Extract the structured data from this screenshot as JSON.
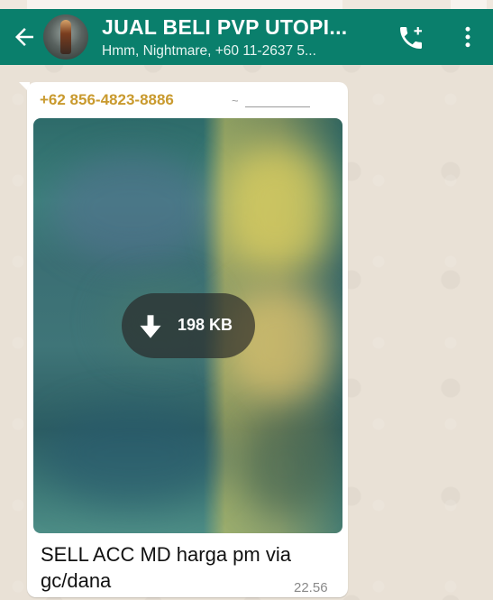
{
  "header": {
    "title": "JUAL BELI PVP UTOPI...",
    "subtitle": "Hmm, Nightmare, +60 11-2637 5...",
    "back_icon": "arrow-left-icon",
    "call_icon": "add-call-icon",
    "menu_icon": "more-vertical-icon",
    "color": "#0a7f6c"
  },
  "message": {
    "sender_phone": "+62 856-4823-8886",
    "sender_name": "~____________...",
    "sender_color": "#c99a2e",
    "media": {
      "download_icon": "download-arrow-icon",
      "size": "198 KB"
    },
    "caption": "SELL ACC MD harga pm via gc/dana",
    "time": "22.56"
  }
}
